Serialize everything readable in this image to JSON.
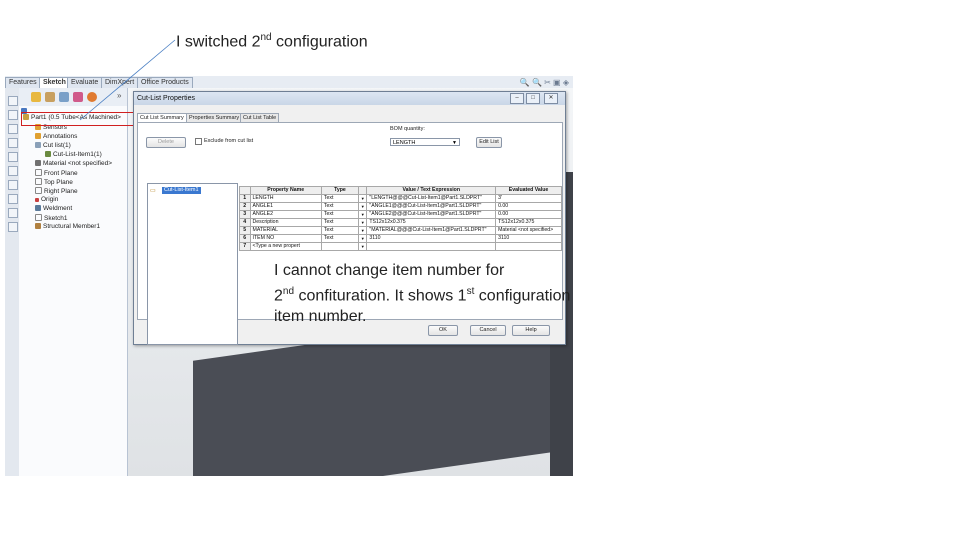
{
  "annotation_top": {
    "pre": "I switched 2",
    "sup": "nd",
    "post": " configuration"
  },
  "annotation_bottom": {
    "line1": "I cannot change item number for",
    "line2_pre": "2",
    "line2_sup": "nd",
    "line2_mid": " confituration. It shows 1",
    "line2_sup2": "st",
    "line2_post": " configuration",
    "line3": "item number."
  },
  "commandmanager": {
    "tabs": [
      "Features",
      "Sketch",
      "Evaluate",
      "DimXpert",
      "Office Products"
    ]
  },
  "feature_tree": {
    "part": "Part1 (0.5 Tube<As Machined>",
    "items": [
      "Sensors",
      "Annotations",
      "Cut list(1)",
      "Cut-List-Item1(1)",
      "Material <not specified>",
      "Front Plane",
      "Top Plane",
      "Right Plane",
      "Origin",
      "Weldment",
      "Sketch1",
      "Structural Member1"
    ]
  },
  "dialog": {
    "title": "Cut-List Properties",
    "tabs": [
      "Cut List Summary",
      "Properties Summary",
      "Cut List Table"
    ],
    "delete_label": "Delete",
    "exclude_label": "Exclude from cut list",
    "bom_label": "BOM quantity:",
    "bom_value": "LENGTH",
    "edit_list_label": "Edit List",
    "list_item": "Cut-List-Item1",
    "ok_label": "OK",
    "cancel_label": "Cancel",
    "help_label": "Help",
    "table": {
      "headers": [
        "Property Name",
        "Type",
        "Value / Text Expression",
        "Evaluated Value"
      ],
      "rows": [
        {
          "n": "1",
          "name": "LENGTH",
          "type": "Text",
          "value": "\"LENGTH@@@Cut-List-Item1@Part1.SLDPRT\"",
          "eval": "3'"
        },
        {
          "n": "2",
          "name": "ANGLE1",
          "type": "Text",
          "value": "\"ANGLE1@@@Cut-List-Item1@Part1.SLDPRT\"",
          "eval": "0.00"
        },
        {
          "n": "3",
          "name": "ANGLE2",
          "type": "Text",
          "value": "\"ANGLE2@@@Cut-List-Item1@Part1.SLDPRT\"",
          "eval": "0.00"
        },
        {
          "n": "4",
          "name": "Description",
          "type": "Text",
          "value": "TS12x12x0.375",
          "eval": "TS12x12x0.375"
        },
        {
          "n": "5",
          "name": "MATERIAL",
          "type": "Text",
          "value": "\"MATERIAL@@@Cut-List-Item1@Part1.SLDPRT\"",
          "eval": "Material <not specified>"
        },
        {
          "n": "6",
          "name": "ITEM NO",
          "type": "Text",
          "value": "3110",
          "eval": "3110"
        },
        {
          "n": "7",
          "name": "<Type a new propert",
          "type": "",
          "value": "",
          "eval": ""
        }
      ]
    }
  }
}
